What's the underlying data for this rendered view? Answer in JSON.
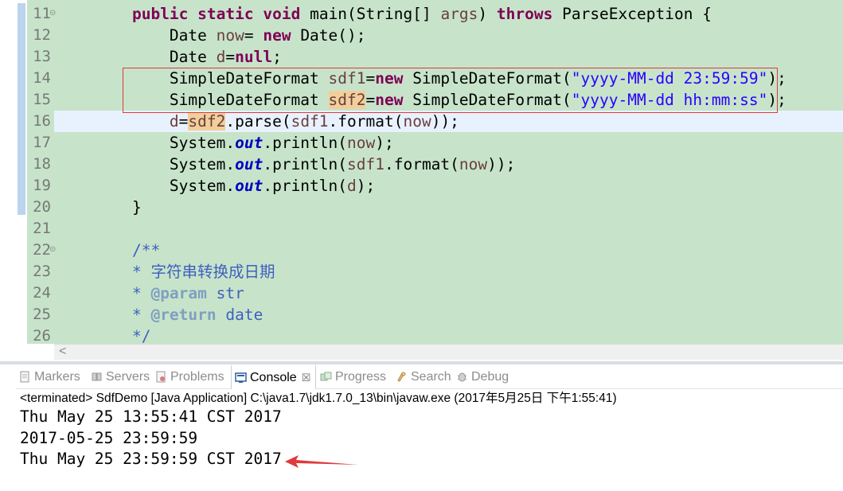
{
  "editor": {
    "lines": [
      {
        "num": "11",
        "fold": "⊝",
        "segments": [
          {
            "t": "    "
          },
          {
            "t": "public",
            "c": "kw"
          },
          {
            "t": " "
          },
          {
            "t": "static",
            "c": "kw"
          },
          {
            "t": " "
          },
          {
            "t": "void",
            "c": "kw"
          },
          {
            "t": " main(String[] "
          },
          {
            "t": "args",
            "c": "var"
          },
          {
            "t": ") "
          },
          {
            "t": "throws",
            "c": "kw"
          },
          {
            "t": " ParseException {"
          }
        ]
      },
      {
        "num": "12",
        "segments": [
          {
            "t": "        Date "
          },
          {
            "t": "now",
            "c": "var"
          },
          {
            "t": "= "
          },
          {
            "t": "new",
            "c": "kw"
          },
          {
            "t": " Date();"
          }
        ]
      },
      {
        "num": "13",
        "segments": [
          {
            "t": "        Date "
          },
          {
            "t": "d",
            "c": "var"
          },
          {
            "t": "="
          },
          {
            "t": "null",
            "c": "kw"
          },
          {
            "t": ";"
          }
        ]
      },
      {
        "num": "14",
        "segments": [
          {
            "t": "        SimpleDateFormat "
          },
          {
            "t": "sdf1",
            "c": "var"
          },
          {
            "t": "="
          },
          {
            "t": "new",
            "c": "kw"
          },
          {
            "t": " SimpleDateFormat("
          },
          {
            "t": "\"yyyy-MM-dd 23:59:59\"",
            "c": "str"
          },
          {
            "t": ");"
          }
        ]
      },
      {
        "num": "15",
        "segments": [
          {
            "t": "        SimpleDateFormat "
          },
          {
            "t": "sdf2",
            "c": "var occ"
          },
          {
            "t": "="
          },
          {
            "t": "new",
            "c": "kw"
          },
          {
            "t": " SimpleDateFormat("
          },
          {
            "t": "\"yyyy-MM-dd hh:mm:ss\"",
            "c": "str"
          },
          {
            "t": ");"
          }
        ]
      },
      {
        "num": "16",
        "current": true,
        "segments": [
          {
            "t": "        "
          },
          {
            "t": "d",
            "c": "var"
          },
          {
            "t": "="
          },
          {
            "t": "sdf2",
            "c": "var occ"
          },
          {
            "t": ".parse("
          },
          {
            "t": "sdf1",
            "c": "var"
          },
          {
            "t": ".format("
          },
          {
            "t": "now",
            "c": "var"
          },
          {
            "t": "));"
          }
        ]
      },
      {
        "num": "17",
        "segments": [
          {
            "t": "        System."
          },
          {
            "t": "out",
            "c": "fld"
          },
          {
            "t": ".println("
          },
          {
            "t": "now",
            "c": "var"
          },
          {
            "t": ");"
          }
        ]
      },
      {
        "num": "18",
        "segments": [
          {
            "t": "        System."
          },
          {
            "t": "out",
            "c": "fld"
          },
          {
            "t": ".println("
          },
          {
            "t": "sdf1",
            "c": "var"
          },
          {
            "t": ".format("
          },
          {
            "t": "now",
            "c": "var"
          },
          {
            "t": "));"
          }
        ]
      },
      {
        "num": "19",
        "segments": [
          {
            "t": "        System."
          },
          {
            "t": "out",
            "c": "fld"
          },
          {
            "t": ".println("
          },
          {
            "t": "d",
            "c": "var"
          },
          {
            "t": ");"
          }
        ]
      },
      {
        "num": "20",
        "segments": [
          {
            "t": "    }"
          }
        ]
      },
      {
        "num": "21",
        "segments": [
          {
            "t": ""
          }
        ]
      },
      {
        "num": "22",
        "fold": "⊝",
        "segments": [
          {
            "t": "    /**",
            "c": "cmt"
          }
        ]
      },
      {
        "num": "23",
        "segments": [
          {
            "t": "    * ",
            "c": "cmt"
          },
          {
            "t": "字符串转换成日期",
            "c": "cmt cjk"
          }
        ]
      },
      {
        "num": "24",
        "segments": [
          {
            "t": "    * ",
            "c": "cmt"
          },
          {
            "t": "@param",
            "c": "tag"
          },
          {
            "t": " str",
            "c": "cmt"
          }
        ]
      },
      {
        "num": "25",
        "segments": [
          {
            "t": "    * ",
            "c": "cmt"
          },
          {
            "t": "@return",
            "c": "tag"
          },
          {
            "t": " date",
            "c": "cmt"
          }
        ]
      },
      {
        "num": "26",
        "segments": [
          {
            "t": "    */",
            "c": "cmt"
          }
        ]
      }
    ],
    "scroll_left_glyph": "<"
  },
  "console": {
    "tabs": [
      {
        "label": "Markers",
        "icon": "markers-icon",
        "active": false
      },
      {
        "label": "Servers",
        "icon": "servers-icon",
        "active": false
      },
      {
        "label": "Problems",
        "icon": "problems-icon",
        "active": false
      },
      {
        "label": "Console",
        "icon": "console-icon",
        "active": true,
        "close": "☒"
      },
      {
        "label": "Progress",
        "icon": "progress-icon",
        "active": false
      },
      {
        "label": "Search",
        "icon": "search-icon",
        "active": false
      },
      {
        "label": "Debug",
        "icon": "debug-icon",
        "active": false
      }
    ],
    "status": "<terminated> SdfDemo [Java Application] C:\\java1.7\\jdk1.7.0_13\\bin\\javaw.exe (2017年5月25日 下午1:55:41)",
    "output": [
      "Thu May 25 13:55:41 CST 2017",
      "2017-05-25 23:59:59",
      "Thu May 25 23:59:59 CST 2017"
    ]
  },
  "colors": {
    "annotation_red": "#e0393c",
    "code_background": "#c7e4ca",
    "keyword": "#7f0055",
    "string": "#2a00ff"
  }
}
